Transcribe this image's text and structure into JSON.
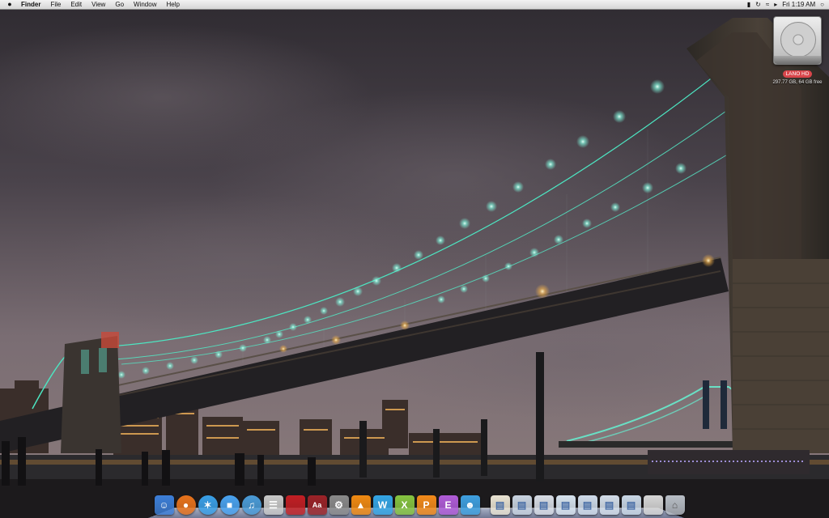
{
  "menubar": {
    "apple": "",
    "app_name": "Finder",
    "menus": [
      "File",
      "Edit",
      "View",
      "Go",
      "Window",
      "Help"
    ],
    "clock": "Fri 1:19 AM",
    "status_icons": [
      "bluetooth-icon",
      "time-machine-icon",
      "wifi-icon",
      "volume-icon",
      "spotlight-icon"
    ]
  },
  "desktop": {
    "drive": {
      "name": "LANO HD",
      "capacity": "297.77 GB",
      "free": "64 GB free"
    }
  },
  "dock": {
    "apps": [
      {
        "name": "finder-icon",
        "color": "#3d7fd8"
      },
      {
        "name": "firefox-icon",
        "color": "#e8731c"
      },
      {
        "name": "safari-icon",
        "color": "#3aa0e8"
      },
      {
        "name": "facetime-icon",
        "color": "#4aa3f0"
      },
      {
        "name": "itunes-icon",
        "color": "#4b9cd8"
      },
      {
        "name": "calculator-icon",
        "color": "#c8c8c8"
      },
      {
        "name": "photo-booth-icon",
        "color": "#c21f24"
      },
      {
        "name": "dictionary-icon",
        "color": "#9b2328"
      },
      {
        "name": "preferences-icon",
        "color": "#8a8a8a"
      },
      {
        "name": "vlc-icon",
        "color": "#f08a12"
      },
      {
        "name": "letter-w-icon",
        "color": "#34a6e6"
      },
      {
        "name": "letter-x-icon",
        "color": "#86c441"
      },
      {
        "name": "letter-p-icon",
        "color": "#f28a1a"
      },
      {
        "name": "letter-e-icon",
        "color": "#b05cd8"
      },
      {
        "name": "messenger-icon",
        "color": "#3fa0e0"
      }
    ],
    "stacks": [
      {
        "name": "applications-folder-icon",
        "color": "#e9e3d2"
      },
      {
        "name": "documents-folder-icon",
        "color": "#c8d3e0"
      },
      {
        "name": "library-folder-icon",
        "color": "#d8dde6"
      },
      {
        "name": "downloads-folder-icon",
        "color": "#d7e3ef"
      },
      {
        "name": "music-folder-icon",
        "color": "#cfdbea"
      },
      {
        "name": "pictures-folder-icon",
        "color": "#d3dde9"
      },
      {
        "name": "sites-folder-icon",
        "color": "#c9d7e6"
      },
      {
        "name": "screen-window-icon",
        "color": "#d6d6d6"
      },
      {
        "name": "trash-icon",
        "color": "#b8bec6"
      }
    ]
  }
}
